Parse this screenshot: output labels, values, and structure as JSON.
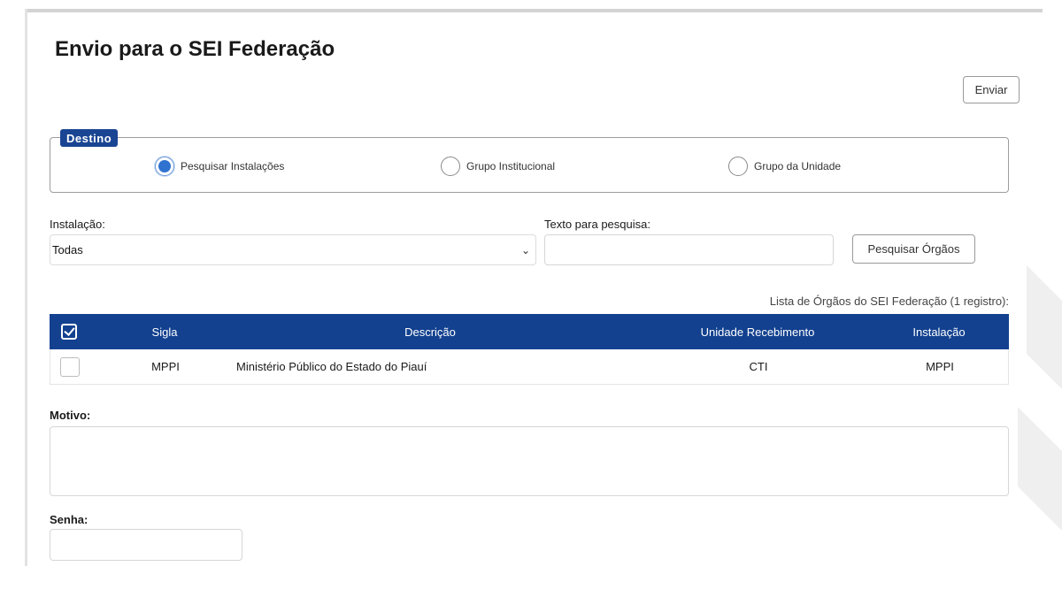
{
  "page": {
    "title": "Envio para o SEI Federação"
  },
  "toolbar": {
    "enviar_label": "Enviar"
  },
  "destino": {
    "legend": "Destino",
    "options": [
      {
        "label": "Pesquisar Instalações",
        "selected": true
      },
      {
        "label": "Grupo Institucional",
        "selected": false
      },
      {
        "label": "Grupo da Unidade",
        "selected": false
      }
    ]
  },
  "filters": {
    "instalacao_label": "Instalação:",
    "instalacao_value": "Todas",
    "texto_label": "Texto para pesquisa:",
    "texto_value": "",
    "pesquisar_label": "Pesquisar Órgãos"
  },
  "list": {
    "caption": "Lista de Órgãos do SEI Federação (1 registro):",
    "columns": [
      "Sigla",
      "Descrição",
      "Unidade Recebimento",
      "Instalação"
    ],
    "rows": [
      {
        "sigla": "MPPI",
        "descricao": "Ministério Público do Estado do Piauí",
        "unidade": "CTI",
        "instalacao": "MPPI",
        "checked": false
      }
    ]
  },
  "form": {
    "motivo_label": "Motivo:",
    "motivo_value": "",
    "senha_label": "Senha:",
    "senha_value": ""
  },
  "colors": {
    "primary": "#13418f",
    "radio_accent": "#2f72d0"
  }
}
